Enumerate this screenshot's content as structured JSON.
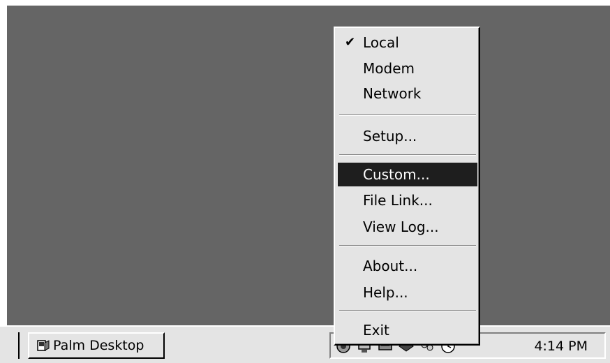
{
  "taskbar": {
    "app_button_label": "Palm Desktop",
    "app_icon": "palm-desktop-icon",
    "tray_icons": [
      "security-icon",
      "network-icon",
      "monitor-icon",
      "hotsync-icon",
      "users-icon",
      "clock-sync-icon"
    ],
    "clock": "4:14 PM"
  },
  "menu": {
    "items": [
      {
        "label": "Local",
        "checked": true
      },
      {
        "label": "Modem"
      },
      {
        "label": "Network"
      },
      {
        "label": "Setup..."
      },
      {
        "label": "Custom...",
        "highlighted": true
      },
      {
        "label": "File Link..."
      },
      {
        "label": "View Log..."
      },
      {
        "label": "About..."
      },
      {
        "label": "Help..."
      },
      {
        "label": "Exit"
      }
    ],
    "check_glyph": "✔"
  },
  "colors": {
    "desktop": "#656565",
    "menu_bg": "#e4e4e4",
    "highlight": "#1e1e1e"
  }
}
